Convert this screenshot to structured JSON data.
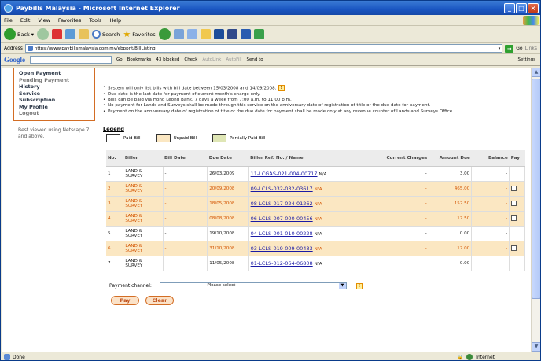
{
  "window": {
    "title": "Paybills Malaysia - Microsoft Internet Explorer"
  },
  "menubar": [
    "File",
    "Edit",
    "View",
    "Favorites",
    "Tools",
    "Help"
  ],
  "toolbar": {
    "back": "Back",
    "search": "Search",
    "favorites": "Favorites"
  },
  "address": {
    "label": "Address",
    "url": "https://www.paybillsmalaysia.com.my/ebppnt/BillListing",
    "go": "Go",
    "links": "Links"
  },
  "googlebar": {
    "logo": "Google",
    "go": "Go",
    "bookmarks": "Bookmarks",
    "blocked": "43 blocked",
    "check": "Check",
    "autolink": "AutoLink",
    "autofill": "AutoFill",
    "sendto": "Send to",
    "settings": "Settings"
  },
  "sidebar": {
    "items": [
      {
        "label": "Open Payment",
        "muted": false
      },
      {
        "label": "Pending Payment",
        "muted": true
      },
      {
        "label": "History",
        "muted": false
      },
      {
        "label": "Service",
        "muted": false
      },
      {
        "label": "Subscription",
        "muted": false
      },
      {
        "label": "My Profile",
        "muted": false
      },
      {
        "label": "Logout",
        "muted": true
      }
    ],
    "best_viewed": "Best viewed using Netscape 7 and above."
  },
  "notes": [
    "System will only list bills with bill date between 15/03/2008 and 14/09/2008.",
    "Due date is the last date for payment of current month's charge only.",
    "Bills can be paid via Hong Leong Bank, 7 days a week from 7:00 a.m. to 11:00 p.m.",
    "No payment for Lands and Surveys shall be made through this service on the anniversary date of registration of title or the due date for payment.",
    "Payment on the anniversary date of registration of title or the due date for payment shall be made only at any revenue counter of Lands and Surveys Office."
  ],
  "legend": {
    "title": "Legend",
    "items": [
      {
        "label": "Paid Bill",
        "color": "#ffffff"
      },
      {
        "label": "Unpaid Bill",
        "color": "#fbe7c2"
      },
      {
        "label": "Partially Paid Bill",
        "color": "#dfe6b5"
      }
    ]
  },
  "table": {
    "headers": [
      "No.",
      "Biller",
      "Bill Date",
      "Due Date",
      "Biller Ref. No. / Name",
      "Current Charges",
      "Amount Due",
      "Balance",
      "Pay"
    ],
    "rows": [
      {
        "no": "1",
        "biller": "LAND & SURVEY",
        "bill_date": "-",
        "due_date": "26/03/2009",
        "ref": "11-LCGAS-021-004-00717",
        "name": "N/A",
        "current": "-",
        "amount": "3.00",
        "balance": "-",
        "status": "paid",
        "pay": false
      },
      {
        "no": "2",
        "biller": "LAND & SURVEY",
        "bill_date": "-",
        "due_date": "20/09/2008",
        "ref": "09-LCLS-032-032-03617",
        "name": "N/A",
        "current": "-",
        "amount": "465.00",
        "balance": "-",
        "status": "unpaid",
        "pay": true
      },
      {
        "no": "3",
        "biller": "LAND & SURVEY",
        "bill_date": "-",
        "due_date": "18/05/2008",
        "ref": "08-LCLS-017-024-01262",
        "name": "N/A",
        "current": "-",
        "amount": "152.50",
        "balance": "-",
        "status": "unpaid",
        "pay": true
      },
      {
        "no": "4",
        "biller": "LAND & SURVEY",
        "bill_date": "-",
        "due_date": "08/08/2008",
        "ref": "06-LCLS-007-000-00456",
        "name": "N/A",
        "current": "-",
        "amount": "17.50",
        "balance": "-",
        "status": "unpaid",
        "pay": true
      },
      {
        "no": "5",
        "biller": "LAND & SURVEY",
        "bill_date": "-",
        "due_date": "19/10/2008",
        "ref": "04-LCLS-001-010-00228",
        "name": "N/A",
        "current": "-",
        "amount": "0.00",
        "balance": "-",
        "status": "paid",
        "pay": false
      },
      {
        "no": "6",
        "biller": "LAND & SURVEY",
        "bill_date": "-",
        "due_date": "31/10/2008",
        "ref": "03-LCLS-019-009-00483",
        "name": "N/A",
        "current": "-",
        "amount": "17.00",
        "balance": "-",
        "status": "unpaid",
        "pay": true
      },
      {
        "no": "7",
        "biller": "LAND & SURVEY",
        "bill_date": "-",
        "due_date": "11/05/2008",
        "ref": "01-LCLS-012-064-06808",
        "name": "N/A",
        "current": "-",
        "amount": "0.00",
        "balance": "-",
        "status": "paid",
        "pay": false
      }
    ]
  },
  "payment": {
    "label": "Payment channel:",
    "selected": "------------------------ Please select ------------------------"
  },
  "buttons": {
    "pay": "Pay",
    "clear": "Clear"
  },
  "status": {
    "left": "Done",
    "zone": "Internet"
  }
}
